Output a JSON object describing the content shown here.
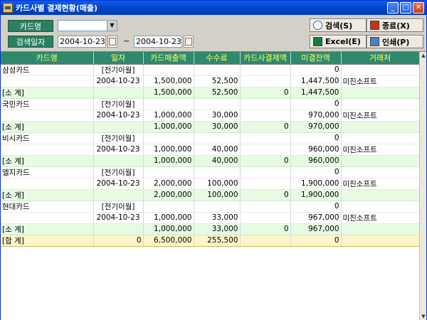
{
  "window": {
    "title": "카드사별 결제현황(매출)",
    "min": "_",
    "max": "□",
    "close": "✕"
  },
  "filters": {
    "card_label": "카드명",
    "card_value": "",
    "date_label": "검색일자",
    "date_from": "2004-10-23",
    "date_to": "2004-10-23",
    "tilde": "~"
  },
  "buttons": {
    "search": "검색(S)",
    "close": "종료(X)",
    "excel": "Excel(E)",
    "print": "인쇄(P)"
  },
  "table": {
    "columns": [
      "카드명",
      "일자",
      "카드매출액",
      "수수료",
      "카드사결제액",
      "미결잔액",
      "거래처"
    ],
    "rows": [
      {
        "type": "data",
        "cells": [
          "삼성카드",
          "[전기이월]",
          "",
          "",
          "",
          "0",
          ""
        ]
      },
      {
        "type": "data",
        "cells": [
          "",
          "2004-10-23",
          "1,500,000",
          "52,500",
          "",
          "1,447,500",
          "미진소프트"
        ]
      },
      {
        "type": "sub",
        "cells": [
          "[소 계]",
          "",
          "1,500,000",
          "52,500",
          "0",
          "1,447,500",
          ""
        ]
      },
      {
        "type": "data",
        "cells": [
          "국민카드",
          "[전기이월]",
          "",
          "",
          "",
          "0",
          ""
        ]
      },
      {
        "type": "data",
        "cells": [
          "",
          "2004-10-23",
          "1,000,000",
          "30,000",
          "",
          "970,000",
          "미진소프트"
        ]
      },
      {
        "type": "sub",
        "cells": [
          "[소 계]",
          "",
          "1,000,000",
          "30,000",
          "0",
          "970,000",
          ""
        ]
      },
      {
        "type": "data",
        "cells": [
          "비시카드",
          "[전기이월]",
          "",
          "",
          "",
          "0",
          ""
        ]
      },
      {
        "type": "data",
        "cells": [
          "",
          "2004-10-23",
          "1,000,000",
          "40,000",
          "",
          "960,000",
          "미진소프트"
        ]
      },
      {
        "type": "sub",
        "cells": [
          "[소 계]",
          "",
          "1,000,000",
          "40,000",
          "0",
          "960,000",
          ""
        ]
      },
      {
        "type": "data",
        "cells": [
          "엘지카드",
          "[전기이월]",
          "",
          "",
          "",
          "0",
          ""
        ]
      },
      {
        "type": "data",
        "cells": [
          "",
          "2004-10-23",
          "2,000,000",
          "100,000",
          "",
          "1,900,000",
          "미진소프트"
        ]
      },
      {
        "type": "sub",
        "cells": [
          "[소 계]",
          "",
          "2,000,000",
          "100,000",
          "0",
          "1,900,000",
          ""
        ]
      },
      {
        "type": "data",
        "cells": [
          "현대카드",
          "[전기이월]",
          "",
          "",
          "",
          "0",
          ""
        ]
      },
      {
        "type": "data",
        "cells": [
          "",
          "2004-10-23",
          "1,000,000",
          "33,000",
          "",
          "967,000",
          "미진소프트"
        ]
      },
      {
        "type": "sub",
        "cells": [
          "[소 계]",
          "",
          "1,000,000",
          "33,000",
          "0",
          "967,000",
          ""
        ]
      },
      {
        "type": "total",
        "cells": [
          "[합 계]",
          "0",
          "6,500,000",
          "255,500",
          "",
          "0",
          ""
        ]
      }
    ]
  }
}
